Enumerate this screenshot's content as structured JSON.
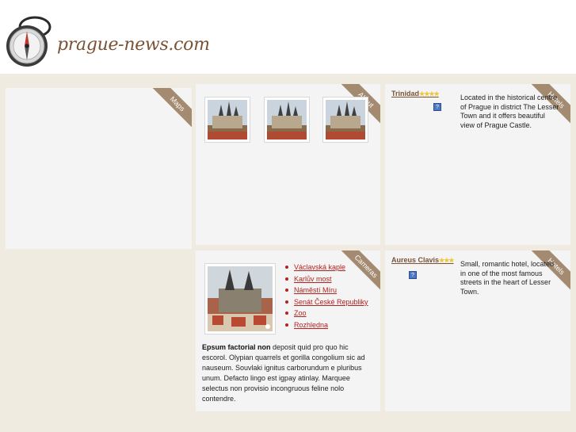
{
  "site": {
    "name": "prague-news.com"
  },
  "panels": {
    "maps": {
      "ribbon": "Maps"
    },
    "about": {
      "ribbon": "About"
    },
    "hotels_top": {
      "ribbon": "Hotels",
      "name": "Trinidad",
      "stars": "★★★★",
      "info_icon": "question-icon",
      "description": "Located in the historical centre of Prague in district The Lesser Town and it offers beautiful view of Prague Castle."
    },
    "cameras": {
      "ribbon": "Cameras",
      "links": [
        "Václavská kaple",
        "Karlův most",
        "Náměstí Míru",
        "Senát České Republiky",
        "Zoo",
        "Rozhledna"
      ],
      "intro_bold": "Epsum factorial non",
      "intro_text": " deposit quid pro quo hic escorol. Olypian quarrels et gorilla congolium sic ad nauseum. Souvlaki ignitus carborundum e pluribus unum. Defacto lingo est igpay atinlay. Marquee selectus non provisio incongruous feline nolo contendre."
    },
    "hotels_bottom": {
      "ribbon": "Hotels",
      "name": "Aureus Clavis",
      "stars": "★★★",
      "info_icon": "question-icon",
      "description": "Small, romantic hotel, located in one of the most famous streets in the heart of Lesser Town."
    }
  },
  "colors": {
    "accent": "#7a5236",
    "ribbon": "#a38a70",
    "link": "#b22222",
    "background": "#f0ebe0",
    "panel": "#f4f4f4"
  }
}
